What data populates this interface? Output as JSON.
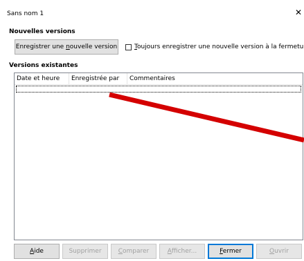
{
  "window": {
    "title": "Sans nom 1",
    "close_glyph": "✕"
  },
  "sections": {
    "new_versions": "Nouvelles versions",
    "existing_versions": "Versions existantes"
  },
  "save_button": {
    "label_pre": "Enregistrer une ",
    "label_mnemonic": "n",
    "label_post": "ouvelle version"
  },
  "always_save": {
    "checked": false,
    "label_mnemonic": "T",
    "label_rest": "oujours enregistrer une nouvelle version à la fermeture"
  },
  "table": {
    "columns": [
      "Date et heure",
      "Enregistrée par",
      "Commentaires"
    ],
    "rows": []
  },
  "buttons": {
    "aide": {
      "mnemonic": "A",
      "rest": "ide",
      "enabled": true
    },
    "supprimer": {
      "label": "Supprimer",
      "enabled": false
    },
    "comparer": {
      "mnemonic": "C",
      "rest": "omparer",
      "enabled": false
    },
    "afficher": {
      "mnemonic": "A",
      "rest": "fficher...",
      "enabled": false
    },
    "fermer": {
      "mnemonic": "F",
      "rest": "ermer",
      "enabled": true,
      "default": true
    },
    "ouvrir": {
      "mnemonic": "O",
      "rest": "uvrir",
      "enabled": false
    }
  },
  "annotation": {
    "color": "#d40000",
    "shape": "arrow-line"
  }
}
